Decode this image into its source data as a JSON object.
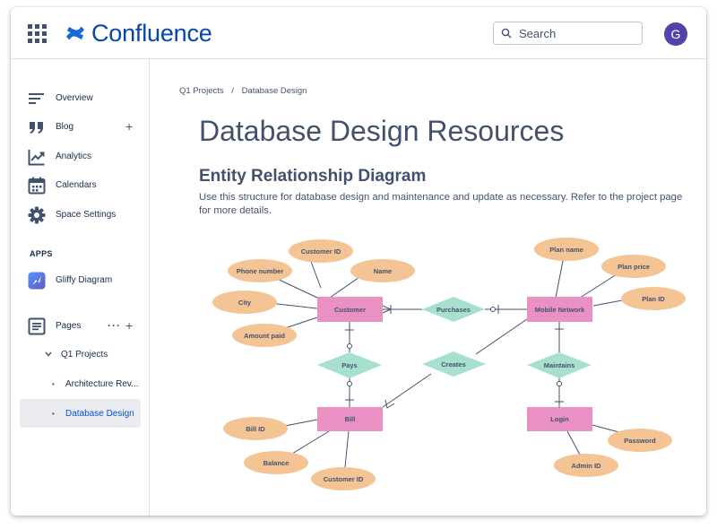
{
  "header": {
    "app_name": "Confluence",
    "search_placeholder": "Search",
    "avatar_initial": "G"
  },
  "sidebar": {
    "nav": [
      {
        "label": "Overview",
        "icon": "overview-icon"
      },
      {
        "label": "Blog",
        "icon": "quote-icon"
      },
      {
        "label": "Analytics",
        "icon": "analytics-chart-icon"
      },
      {
        "label": "Calendars",
        "icon": "calendar-icon"
      },
      {
        "label": "Space Settings",
        "icon": "gear-icon"
      }
    ],
    "apps_heading": "APPS",
    "apps": [
      {
        "label": "Gliffy Diagram",
        "icon": "gliffy-icon"
      }
    ],
    "pages_label": "Pages",
    "tree": [
      {
        "label": "Q1 Projects"
      },
      {
        "label": "Architecture Rev..."
      },
      {
        "label": "Database Design"
      }
    ]
  },
  "breadcrumb": [
    "Q1 Projects",
    "Database Design"
  ],
  "page": {
    "title": "Database Design Resources",
    "section_heading": "Entity Relationship Diagram",
    "description": "Use this structure for database design and maintenance and update as necessary. Refer to the project page for more details."
  },
  "diagram": {
    "colors": {
      "entity": "#e991c3",
      "attribute": "#f4c495",
      "relationship": "#a8e0d0",
      "line": "#42526e"
    },
    "entities": [
      "Customer",
      "Mobile Network",
      "Bill",
      "Login"
    ],
    "relationships": [
      "Purchases",
      "Pays",
      "Creates",
      "Maintains"
    ],
    "attributes": {
      "customer": [
        "Customer ID",
        "Phone number",
        "Name",
        "City",
        "Amount paid"
      ],
      "mobile_network": [
        "Plan name",
        "Plan price",
        "Plan ID"
      ],
      "bill": [
        "Bill ID",
        "Balance",
        "Customer ID"
      ],
      "login": [
        "Password",
        "Admin ID"
      ]
    }
  },
  "colors": {
    "brand": "#0052cc",
    "avatar": "#5243aa",
    "text": "#42526e"
  }
}
